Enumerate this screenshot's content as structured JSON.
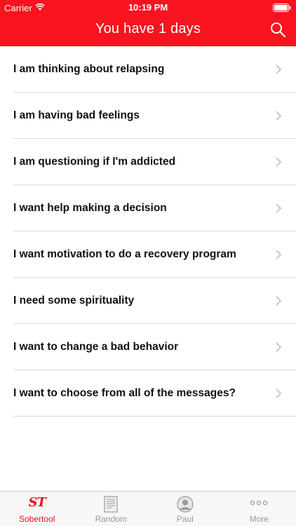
{
  "status_bar": {
    "carrier": "Carrier",
    "time": "10:19 PM",
    "wifi_icon": "wifi-icon",
    "battery_icon": "battery-icon"
  },
  "nav": {
    "title": "You have 1 days",
    "search_icon": "search-icon",
    "accent_color": "#f8131f"
  },
  "list": {
    "items": [
      {
        "label": "I am thinking about relapsing"
      },
      {
        "label": "I am having bad feelings"
      },
      {
        "label": "I am questioning if I'm addicted"
      },
      {
        "label": "I want help making a decision"
      },
      {
        "label": "I want motivation to do a recovery program"
      },
      {
        "label": "I need some spirituality"
      },
      {
        "label": "I want to change a bad behavior"
      },
      {
        "label": "I want to choose from all of the messages?"
      }
    ],
    "chevron_icon": "chevron-right-icon"
  },
  "tabbar": {
    "tabs": [
      {
        "label": "Sobertool",
        "icon": "sobertool-logo-icon",
        "logo_text": "ST",
        "active": true
      },
      {
        "label": "Random",
        "icon": "document-icon",
        "active": false
      },
      {
        "label": "Paul",
        "icon": "person-icon",
        "active": false
      },
      {
        "label": "More",
        "icon": "more-icon",
        "active": false
      }
    ],
    "active_color": "#e8101b",
    "inactive_color": "#9a9a9a"
  }
}
